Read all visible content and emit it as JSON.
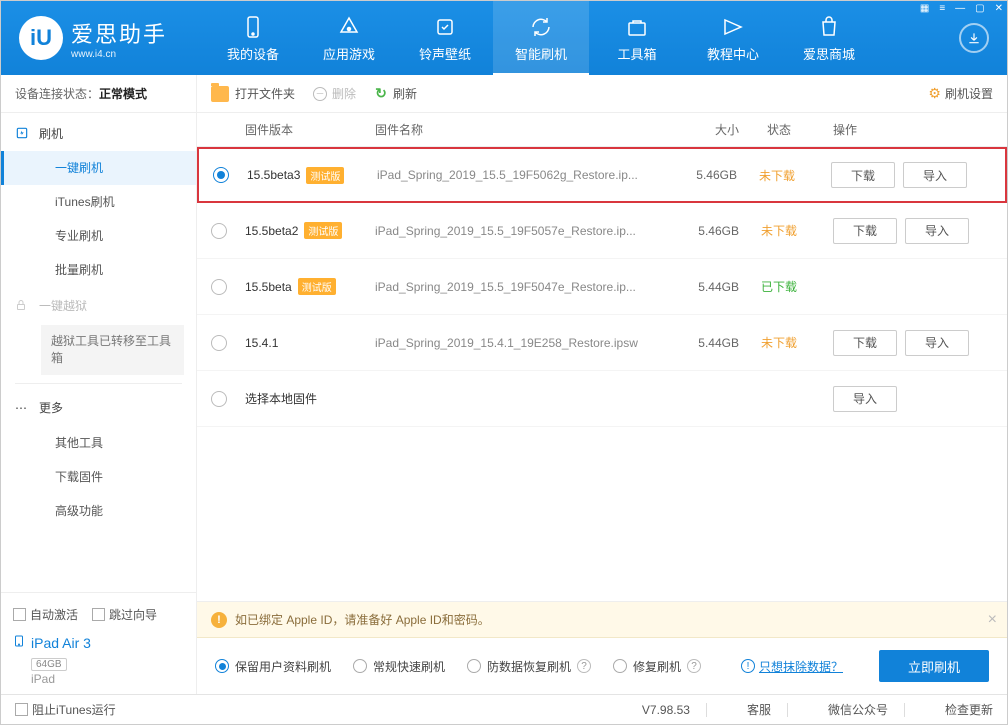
{
  "titlebar": {
    "app_name": "爱思助手",
    "app_domain": "www.i4.cn",
    "logo_letter": "iU"
  },
  "nav": [
    {
      "label": "我的设备"
    },
    {
      "label": "应用游戏"
    },
    {
      "label": "铃声壁纸"
    },
    {
      "label": "智能刷机"
    },
    {
      "label": "工具箱"
    },
    {
      "label": "教程中心"
    },
    {
      "label": "爱思商城"
    }
  ],
  "nav_active_index": 3,
  "device_state_label": "设备连接状态：",
  "device_state_value": "正常模式",
  "toolbar": {
    "open_folder": "打开文件夹",
    "delete": "删除",
    "refresh": "刷新",
    "settings": "刷机设置"
  },
  "sidebar": {
    "flash_cat": "刷机",
    "flash_subs": [
      "一键刷机",
      "iTunes刷机",
      "专业刷机",
      "批量刷机"
    ],
    "flash_active_index": 0,
    "jailbreak_cat": "一键越狱",
    "jailbreak_note": "越狱工具已转移至工具箱",
    "more_cat": "更多",
    "more_subs": [
      "其他工具",
      "下载固件",
      "高级功能"
    ],
    "auto_activate": "自动激活",
    "skip_guide": "跳过向导",
    "device_name": "iPad Air 3",
    "device_capacity": "64GB",
    "device_type": "iPad"
  },
  "table_header": {
    "version": "固件版本",
    "name": "固件名称",
    "size": "大小",
    "status": "状态",
    "ops": "操作"
  },
  "firmware_rows": [
    {
      "version": "15.5beta3",
      "beta": "测试版",
      "name": "iPad_Spring_2019_15.5_19F5062g_Restore.ip...",
      "size": "5.46GB",
      "status": "未下载",
      "status_class": "st-notdl",
      "selected": true,
      "show_dl": true
    },
    {
      "version": "15.5beta2",
      "beta": "测试版",
      "name": "iPad_Spring_2019_15.5_19F5057e_Restore.ip...",
      "size": "5.46GB",
      "status": "未下载",
      "status_class": "st-notdl",
      "selected": false,
      "show_dl": true
    },
    {
      "version": "15.5beta",
      "beta": "测试版",
      "name": "iPad_Spring_2019_15.5_19F5047e_Restore.ip...",
      "size": "5.44GB",
      "status": "已下载",
      "status_class": "st-done",
      "selected": false,
      "show_dl": false
    },
    {
      "version": "15.4.1",
      "beta": "",
      "name": "iPad_Spring_2019_15.4.1_19E258_Restore.ipsw",
      "size": "5.44GB",
      "status": "未下载",
      "status_class": "st-notdl",
      "selected": false,
      "show_dl": true
    }
  ],
  "local_row_label": "选择本地固件",
  "btn_download": "下载",
  "btn_import": "导入",
  "notice_text": "如已绑定 Apple ID，请准备好 Apple ID和密码。",
  "flash_options": [
    {
      "label": "保留用户资料刷机",
      "help": false
    },
    {
      "label": "常规快速刷机",
      "help": false
    },
    {
      "label": "防数据恢复刷机",
      "help": true
    },
    {
      "label": "修复刷机",
      "help": true
    }
  ],
  "flash_option_selected": 0,
  "erase_link": "只想抹除数据？",
  "flash_now_btn": "立即刷机",
  "statusbar": {
    "block_itunes": "阻止iTunes运行",
    "version": "V7.98.53",
    "service": "客服",
    "wechat": "微信公众号",
    "update": "检查更新"
  }
}
